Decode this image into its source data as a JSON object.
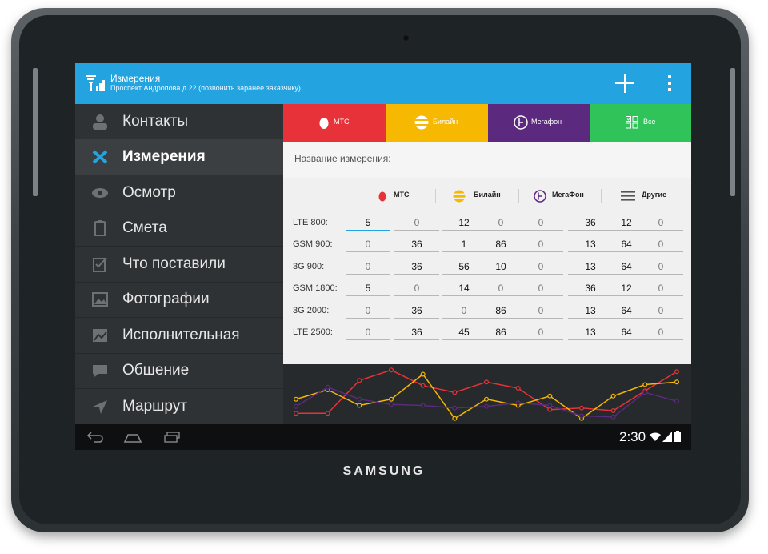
{
  "device": {
    "brand": "SAMSUNG"
  },
  "header": {
    "title": "Измерения",
    "subtitle": "Проспект Андропова д.22 (позвонить заранее заказчику)"
  },
  "sidebar": {
    "items": [
      {
        "label": "Контакты",
        "icon": "contact-icon"
      },
      {
        "label": "Измерения",
        "icon": "measure-icon",
        "active": true
      },
      {
        "label": "Осмотр",
        "icon": "eye-icon"
      },
      {
        "label": "Смета",
        "icon": "clipboard-icon"
      },
      {
        "label": "Что поставили",
        "icon": "checklist-icon"
      },
      {
        "label": "Фотографии",
        "icon": "photo-icon"
      },
      {
        "label": "Исполнительная",
        "icon": "document-icon"
      },
      {
        "label": "Обшение",
        "icon": "chat-icon"
      },
      {
        "label": "Маршрут",
        "icon": "navigation-icon"
      }
    ]
  },
  "operator_tabs": [
    {
      "label": "МТС",
      "color": "#e63238"
    },
    {
      "label": "Билайн",
      "color": "#f6b800"
    },
    {
      "label": "Мегафон",
      "color": "#5b2a7e"
    },
    {
      "label": "Все",
      "color": "#2fc35a"
    }
  ],
  "form": {
    "name_placeholder": "Название измерения:"
  },
  "table": {
    "columns": [
      "МТС",
      "Билайн",
      "МегаФон",
      "Другие"
    ],
    "rows": [
      {
        "label": "LTE 800:",
        "values": [
          "5",
          "0",
          "12",
          "0",
          "0",
          "36",
          "12",
          "0"
        ]
      },
      {
        "label": "GSM 900:",
        "values": [
          "0",
          "36",
          "1",
          "86",
          "0",
          "13",
          "64",
          "0"
        ]
      },
      {
        "label": "3G 900:",
        "values": [
          "0",
          "36",
          "56",
          "10",
          "0",
          "13",
          "64",
          "0"
        ]
      },
      {
        "label": "GSM 1800:",
        "values": [
          "5",
          "0",
          "14",
          "0",
          "0",
          "36",
          "12",
          "0"
        ]
      },
      {
        "label": "3G 2000:",
        "values": [
          "0",
          "36",
          "0",
          "86",
          "0",
          "13",
          "64",
          "0"
        ]
      },
      {
        "label": "LTE 2500:",
        "values": [
          "0",
          "36",
          "45",
          "86",
          "0",
          "13",
          "64",
          "0"
        ]
      }
    ]
  },
  "chart_data": {
    "type": "line",
    "title": "",
    "xlabel": "",
    "ylabel": "",
    "ylim": [
      0,
      10
    ],
    "grid": false,
    "x": [
      1,
      2,
      3,
      4,
      5,
      6,
      7,
      8,
      9,
      10,
      11,
      12,
      13
    ],
    "series": [
      {
        "color": "#e63238",
        "values": [
          1.5,
          1.5,
          7.8,
          9.8,
          6.8,
          5.5,
          7.5,
          6.3,
          2.2,
          2.5,
          2.0,
          5.8,
          9.5
        ]
      },
      {
        "color": "#f6b800",
        "values": [
          4.2,
          6.0,
          3.0,
          4.2,
          9.0,
          0.5,
          4.2,
          3.0,
          4.8,
          0.5,
          4.8,
          7.0,
          7.5
        ]
      },
      {
        "color": "#5b2a7e",
        "values": [
          2.8,
          6.5,
          4.2,
          3.2,
          3.0,
          2.5,
          2.8,
          3.5,
          3.0,
          1.0,
          0.8,
          5.5,
          3.8
        ]
      }
    ]
  },
  "status": {
    "time": "2:30"
  }
}
